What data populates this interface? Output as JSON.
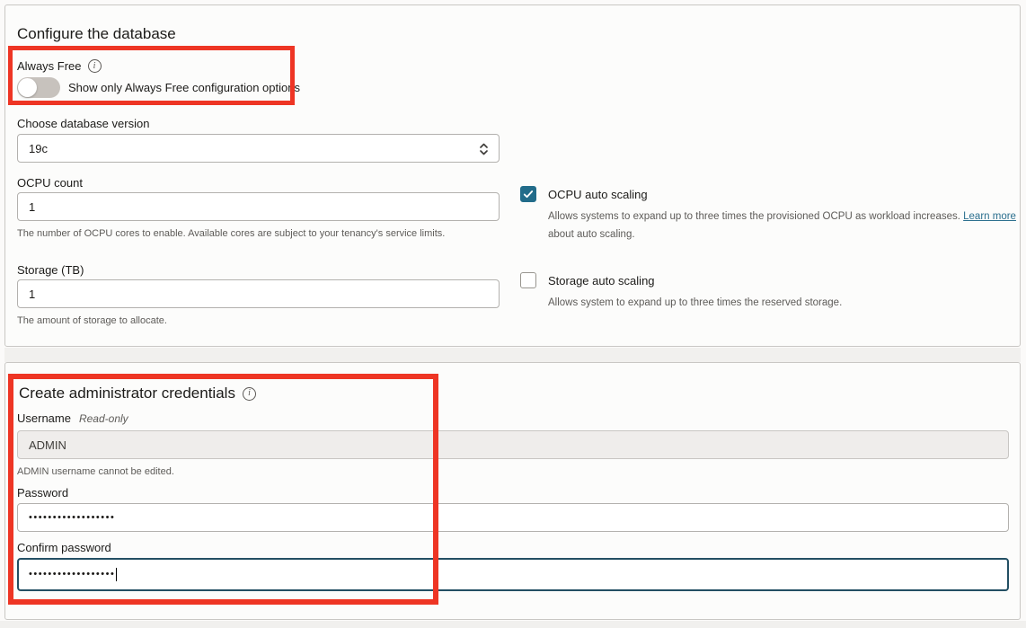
{
  "icons": {
    "info_glyph": "i"
  },
  "colors": {
    "annotation_red": "#ee3524",
    "checkbox_checked": "#226c8a",
    "focused_border": "#234f63",
    "link": "#2b6f8e",
    "card_border": "#c9c7c4"
  },
  "configure_card": {
    "title": "Configure the database",
    "always_free": {
      "label": "Always Free",
      "toggle_label": "Show only Always Free configuration options",
      "enabled": false
    },
    "db_version": {
      "label": "Choose database version",
      "value": "19c"
    },
    "ocpu": {
      "label": "OCPU count",
      "value": "1",
      "help": "The number of OCPU cores to enable. Available cores are subject to your tenancy's service limits."
    },
    "ocpu_autoscale": {
      "label": "OCPU auto scaling",
      "checked": true,
      "desc_before": "Allows systems to expand up to three times the provisioned OCPU as workload increases. ",
      "link_label": "Learn more",
      "desc_after": " about auto scaling."
    },
    "storage": {
      "label": "Storage (TB)",
      "value": "1",
      "help": "The amount of storage to allocate."
    },
    "storage_autoscale": {
      "label": "Storage auto scaling",
      "checked": false,
      "desc": "Allows system to expand up to three times the reserved storage."
    }
  },
  "credentials_card": {
    "title": "Create administrator credentials",
    "username": {
      "label": "Username",
      "readonly_tag": "Read-only",
      "value": "ADMIN",
      "help": "ADMIN username cannot be edited."
    },
    "password": {
      "label": "Password",
      "masked_value": "••••••••••••••••••"
    },
    "confirm_password": {
      "label": "Confirm password",
      "masked_value": "••••••••••••••••••"
    }
  }
}
